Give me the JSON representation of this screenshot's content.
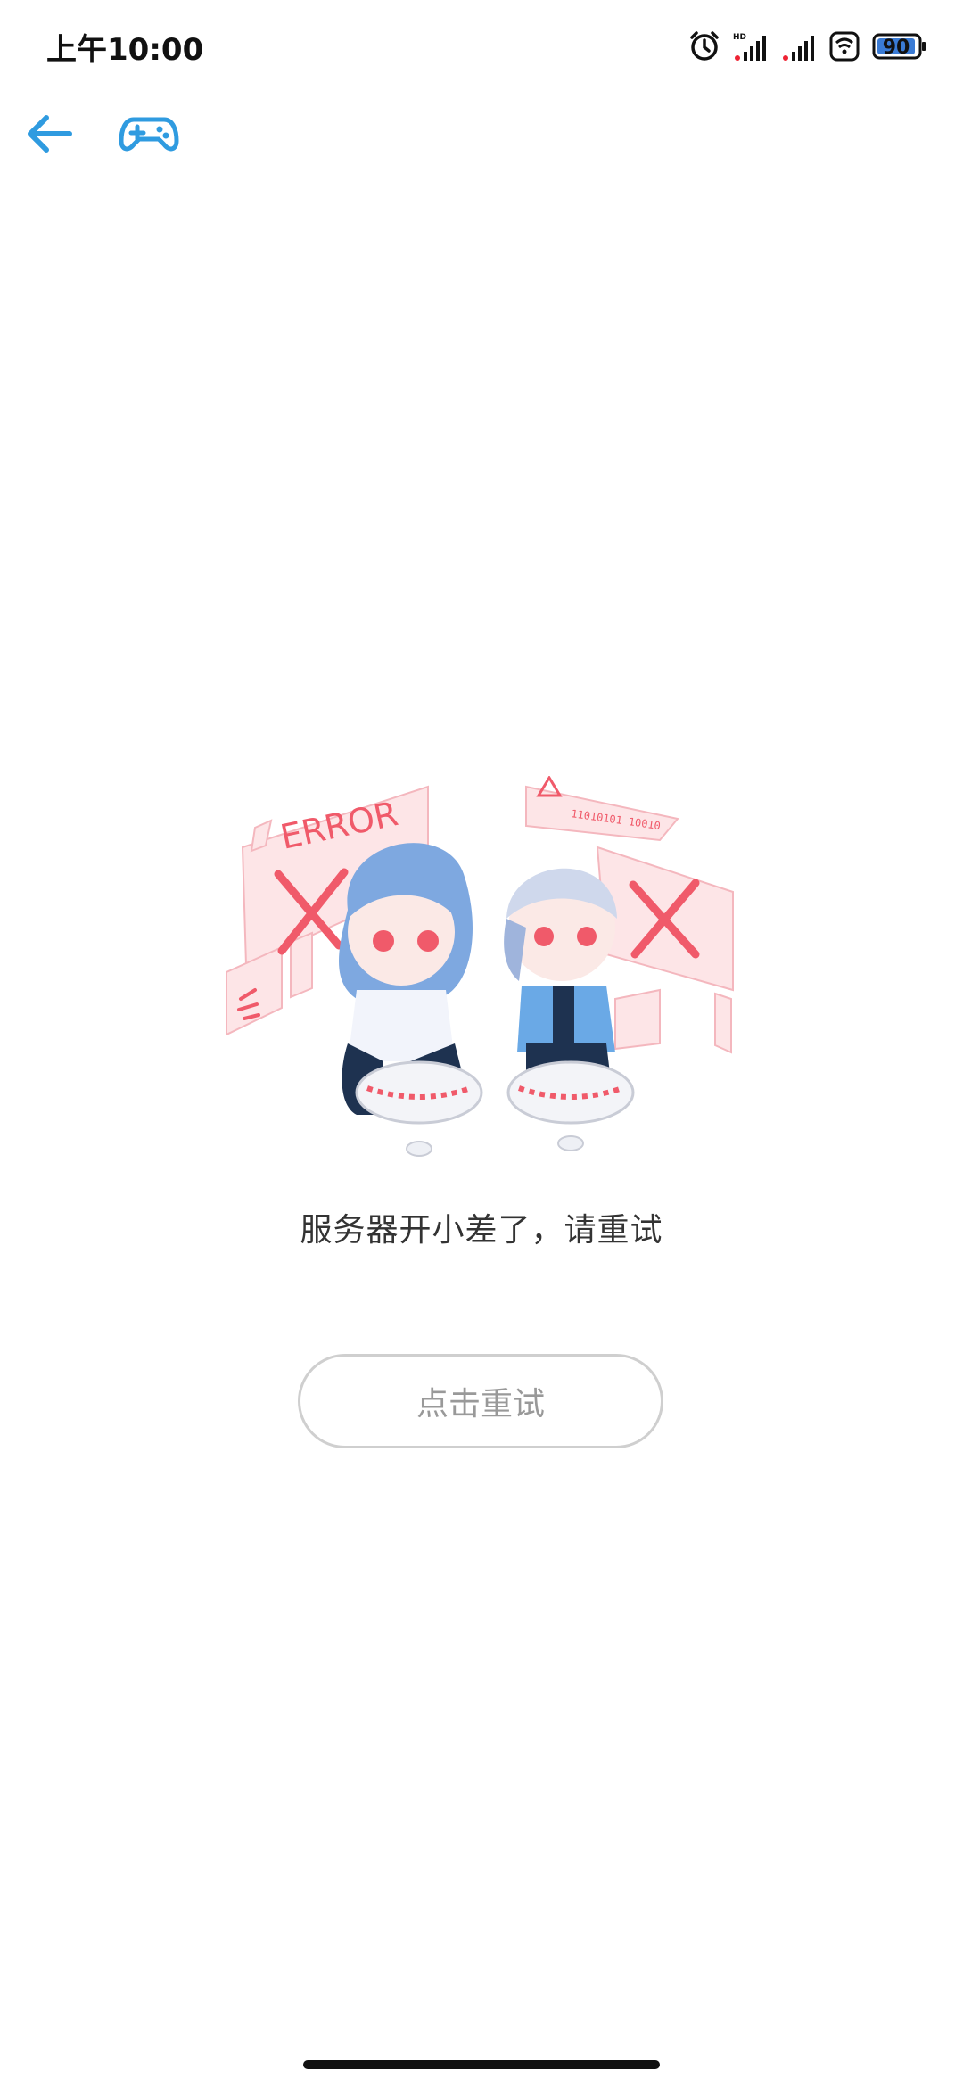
{
  "status_bar": {
    "time": "上午10:00",
    "battery_level": "90",
    "icons": [
      "alarm-icon",
      "hd-signal-icon",
      "signal-icon",
      "wifi-icon",
      "battery-icon"
    ]
  },
  "toolbar": {
    "back_icon": "arrow-left-icon",
    "game_icon": "gamepad-icon",
    "accent_color": "#2f9be0"
  },
  "illustration": {
    "error_label": "ERROR",
    "binary_label": "11010101 10010",
    "accent_color": "#f05a6a"
  },
  "error": {
    "message": "服务器开小差了，请重试"
  },
  "retry": {
    "label": "点击重试"
  }
}
